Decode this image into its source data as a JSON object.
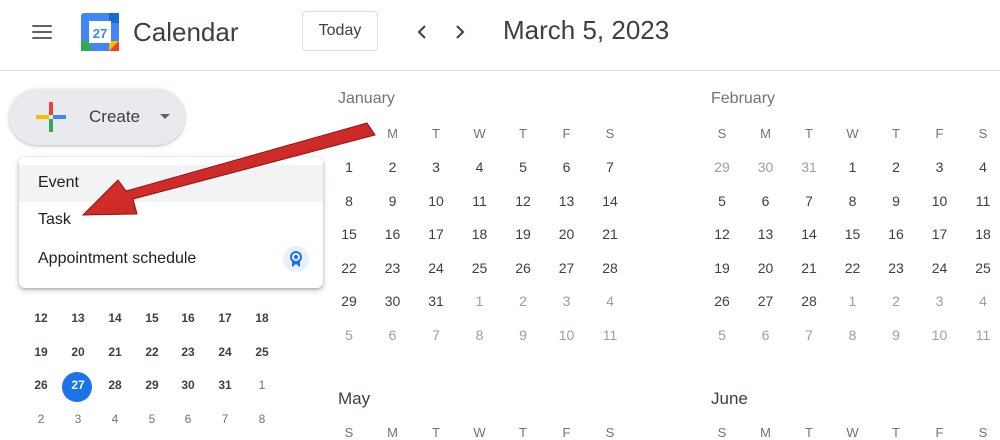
{
  "header": {
    "app_title": "Calendar",
    "logo_day": "27",
    "today_label": "Today",
    "date_title": "March 5, 2023"
  },
  "sidebar": {
    "create_label": "Create",
    "dropdown": [
      {
        "label": "Event",
        "highlighted": true
      },
      {
        "label": "Task",
        "highlighted": false
      },
      {
        "label": "Appointment schedule",
        "highlighted": false,
        "icon": "badge-icon"
      }
    ],
    "mini_calendar": {
      "rows": [
        [
          {
            "d": "12"
          },
          {
            "d": "13"
          },
          {
            "d": "14"
          },
          {
            "d": "15"
          },
          {
            "d": "16"
          },
          {
            "d": "17"
          },
          {
            "d": "18"
          }
        ],
        [
          {
            "d": "19"
          },
          {
            "d": "20"
          },
          {
            "d": "21"
          },
          {
            "d": "22"
          },
          {
            "d": "23"
          },
          {
            "d": "24"
          },
          {
            "d": "25"
          }
        ],
        [
          {
            "d": "26"
          },
          {
            "d": "27",
            "selected": true
          },
          {
            "d": "28"
          },
          {
            "d": "29"
          },
          {
            "d": "30"
          },
          {
            "d": "31"
          },
          {
            "d": "1",
            "other": true
          }
        ],
        [
          {
            "d": "2",
            "other": true
          },
          {
            "d": "3",
            "other": true
          },
          {
            "d": "4",
            "other": true
          },
          {
            "d": "5",
            "other": true
          },
          {
            "d": "6",
            "other": true
          },
          {
            "d": "7",
            "other": true
          },
          {
            "d": "8",
            "other": true
          }
        ]
      ]
    }
  },
  "weekdays": [
    "S",
    "M",
    "T",
    "W",
    "T",
    "F",
    "S"
  ],
  "months": [
    {
      "name": "January",
      "weeks": [
        [
          {
            "d": "1"
          },
          {
            "d": "2"
          },
          {
            "d": "3"
          },
          {
            "d": "4"
          },
          {
            "d": "5"
          },
          {
            "d": "6"
          },
          {
            "d": "7"
          }
        ],
        [
          {
            "d": "8"
          },
          {
            "d": "9"
          },
          {
            "d": "10"
          },
          {
            "d": "11"
          },
          {
            "d": "12"
          },
          {
            "d": "13"
          },
          {
            "d": "14"
          }
        ],
        [
          {
            "d": "15"
          },
          {
            "d": "16"
          },
          {
            "d": "17"
          },
          {
            "d": "18"
          },
          {
            "d": "19"
          },
          {
            "d": "20"
          },
          {
            "d": "21"
          }
        ],
        [
          {
            "d": "22"
          },
          {
            "d": "23"
          },
          {
            "d": "24"
          },
          {
            "d": "25"
          },
          {
            "d": "26"
          },
          {
            "d": "27"
          },
          {
            "d": "28"
          }
        ],
        [
          {
            "d": "29"
          },
          {
            "d": "30"
          },
          {
            "d": "31"
          },
          {
            "d": "1",
            "other": true
          },
          {
            "d": "2",
            "other": true
          },
          {
            "d": "3",
            "other": true
          },
          {
            "d": "4",
            "other": true
          }
        ],
        [
          {
            "d": "5",
            "other": true
          },
          {
            "d": "6",
            "other": true
          },
          {
            "d": "7",
            "other": true
          },
          {
            "d": "8",
            "other": true
          },
          {
            "d": "9",
            "other": true
          },
          {
            "d": "10",
            "other": true
          },
          {
            "d": "11",
            "other": true
          }
        ]
      ]
    },
    {
      "name": "February",
      "weeks": [
        [
          {
            "d": "29",
            "other": true
          },
          {
            "d": "30",
            "other": true
          },
          {
            "d": "31",
            "other": true
          },
          {
            "d": "1"
          },
          {
            "d": "2"
          },
          {
            "d": "3"
          },
          {
            "d": "4"
          }
        ],
        [
          {
            "d": "5"
          },
          {
            "d": "6"
          },
          {
            "d": "7"
          },
          {
            "d": "8"
          },
          {
            "d": "9"
          },
          {
            "d": "10"
          },
          {
            "d": "11"
          }
        ],
        [
          {
            "d": "12"
          },
          {
            "d": "13"
          },
          {
            "d": "14"
          },
          {
            "d": "15"
          },
          {
            "d": "16"
          },
          {
            "d": "17"
          },
          {
            "d": "18"
          }
        ],
        [
          {
            "d": "19"
          },
          {
            "d": "20"
          },
          {
            "d": "21"
          },
          {
            "d": "22"
          },
          {
            "d": "23"
          },
          {
            "d": "24"
          },
          {
            "d": "25"
          }
        ],
        [
          {
            "d": "26"
          },
          {
            "d": "27"
          },
          {
            "d": "28"
          },
          {
            "d": "1",
            "other": true
          },
          {
            "d": "2",
            "other": true
          },
          {
            "d": "3",
            "other": true
          },
          {
            "d": "4",
            "other": true
          }
        ],
        [
          {
            "d": "5",
            "other": true
          },
          {
            "d": "6",
            "other": true
          },
          {
            "d": "7",
            "other": true
          },
          {
            "d": "8",
            "other": true
          },
          {
            "d": "9",
            "other": true
          },
          {
            "d": "10",
            "other": true
          },
          {
            "d": "11",
            "other": true
          }
        ]
      ]
    }
  ],
  "lower_months": [
    "May",
    "June"
  ],
  "colors": {
    "accent": "#1a73e8",
    "annotation_arrow": "#cc1f1f"
  }
}
